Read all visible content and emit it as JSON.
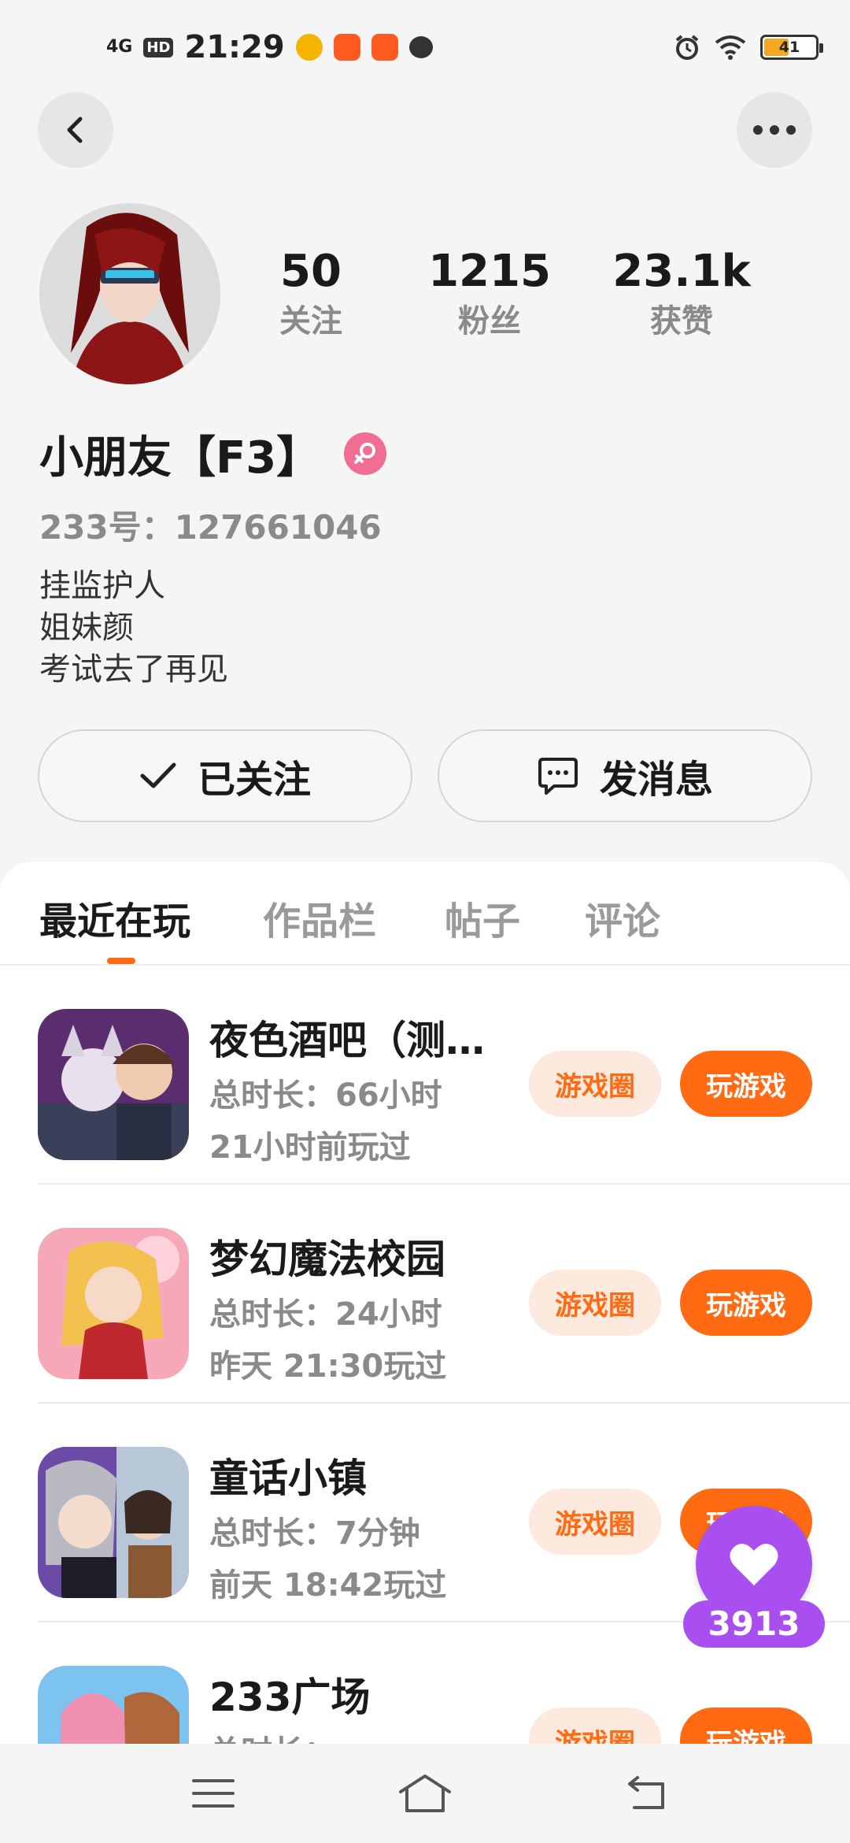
{
  "status_bar": {
    "signal": "4G",
    "hd": "HD",
    "time": "21:29",
    "battery": "41"
  },
  "profile": {
    "stats": [
      {
        "value": "50",
        "label": "关注"
      },
      {
        "value": "1215",
        "label": "粉丝"
      },
      {
        "value": "23.1k",
        "label": "获赞"
      }
    ],
    "username": "小朋友【F3】",
    "uid": "233号：127661046",
    "bio": [
      "挂监护人",
      "姐妹颜",
      "考试去了再见"
    ]
  },
  "actions": {
    "follow_label": "已关注",
    "message_label": "发消息"
  },
  "tabs": [
    "最近在玩",
    "作品栏",
    "帖子",
    "评论"
  ],
  "games": [
    {
      "title": "夜色酒吧（测…",
      "duration": "总时长：66小时",
      "last_played": "21小时前玩过",
      "circle_label": "游戏圈",
      "play_label": "玩游戏"
    },
    {
      "title": "梦幻魔法校园",
      "duration": "总时长：24小时",
      "last_played": "昨天 21:30玩过",
      "circle_label": "游戏圈",
      "play_label": "玩游戏"
    },
    {
      "title": "童话小镇",
      "duration": "总时长：7分钟",
      "last_played": "前天 18:42玩过",
      "circle_label": "游戏圈",
      "play_label": "玩游戏"
    },
    {
      "title": "233广场",
      "duration": "总时长：",
      "last_played": "",
      "circle_label": "游戏圈",
      "play_label": "玩游戏"
    }
  ],
  "like_float": {
    "count": "3913"
  },
  "colors": {
    "accent": "#ff6a13",
    "accent_soft": "#fde9dd",
    "like": "#a94ff0",
    "gender": "#f06d94"
  }
}
